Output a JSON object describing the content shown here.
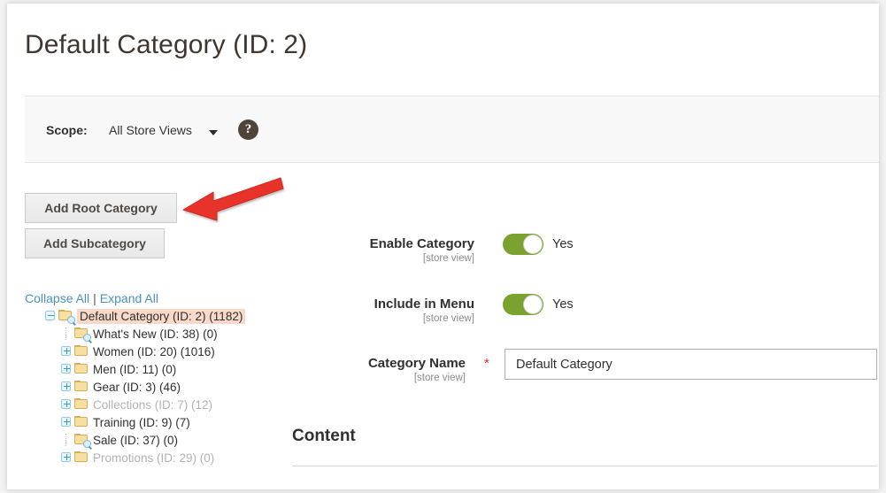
{
  "page": {
    "title": "Default Category (ID: 2)"
  },
  "scope": {
    "label": "Scope:",
    "value": "All Store Views",
    "help_icon": "question-mark-icon",
    "caret_icon": "chevron-down-icon"
  },
  "buttons": {
    "add_root_category": "Add Root Category",
    "add_subcategory": "Add Subcategory"
  },
  "annotation": {
    "type": "arrow",
    "color": "#e8332a",
    "points_to": "Add Root Category",
    "direction": "left"
  },
  "tree_controls": {
    "collapse_all": "Collapse All",
    "separator": "|",
    "expand_all": "Expand All"
  },
  "tree": {
    "items": [
      {
        "label": "Default Category (ID: 2) (1182)",
        "level": 0,
        "expander": "minus",
        "icon": "folder-search-icon",
        "selected": true,
        "disabled": false
      },
      {
        "label": "What's New (ID: 38) (0)",
        "level": 1,
        "expander": "none",
        "icon": "folder-search-icon",
        "selected": false,
        "disabled": false
      },
      {
        "label": "Women (ID: 20) (1016)",
        "level": 1,
        "expander": "plus",
        "icon": "folder-icon",
        "selected": false,
        "disabled": false
      },
      {
        "label": "Men (ID: 11) (0)",
        "level": 1,
        "expander": "plus",
        "icon": "folder-icon",
        "selected": false,
        "disabled": false
      },
      {
        "label": "Gear (ID: 3) (46)",
        "level": 1,
        "expander": "plus",
        "icon": "folder-icon",
        "selected": false,
        "disabled": false
      },
      {
        "label": "Collections (ID: 7) (12)",
        "level": 1,
        "expander": "plus",
        "icon": "folder-icon",
        "selected": false,
        "disabled": true
      },
      {
        "label": "Training (ID: 9) (7)",
        "level": 1,
        "expander": "plus",
        "icon": "folder-icon",
        "selected": false,
        "disabled": false
      },
      {
        "label": "Sale (ID: 37) (0)",
        "level": 1,
        "expander": "none",
        "icon": "folder-search-icon",
        "selected": false,
        "disabled": false
      },
      {
        "label": "Promotions (ID: 29) (0)",
        "level": 1,
        "expander": "plus",
        "icon": "folder-icon",
        "selected": false,
        "disabled": true
      }
    ]
  },
  "form": {
    "enable_category": {
      "label": "Enable Category",
      "scope": "[store view]",
      "value": "Yes",
      "state": "on"
    },
    "include_in_menu": {
      "label": "Include in Menu",
      "scope": "[store view]",
      "value": "Yes",
      "state": "on"
    },
    "category_name": {
      "label": "Category Name",
      "scope": "[store view]",
      "required_marker": "*",
      "value": "Default Category",
      "placeholder": ""
    }
  },
  "content_section": {
    "title": "Content"
  },
  "colors": {
    "toggle_on": "#79a22e",
    "link": "#4b8fc2",
    "selected_row": "#f8d9c9",
    "required": "#e02b27",
    "arrow": "#e8332a"
  }
}
